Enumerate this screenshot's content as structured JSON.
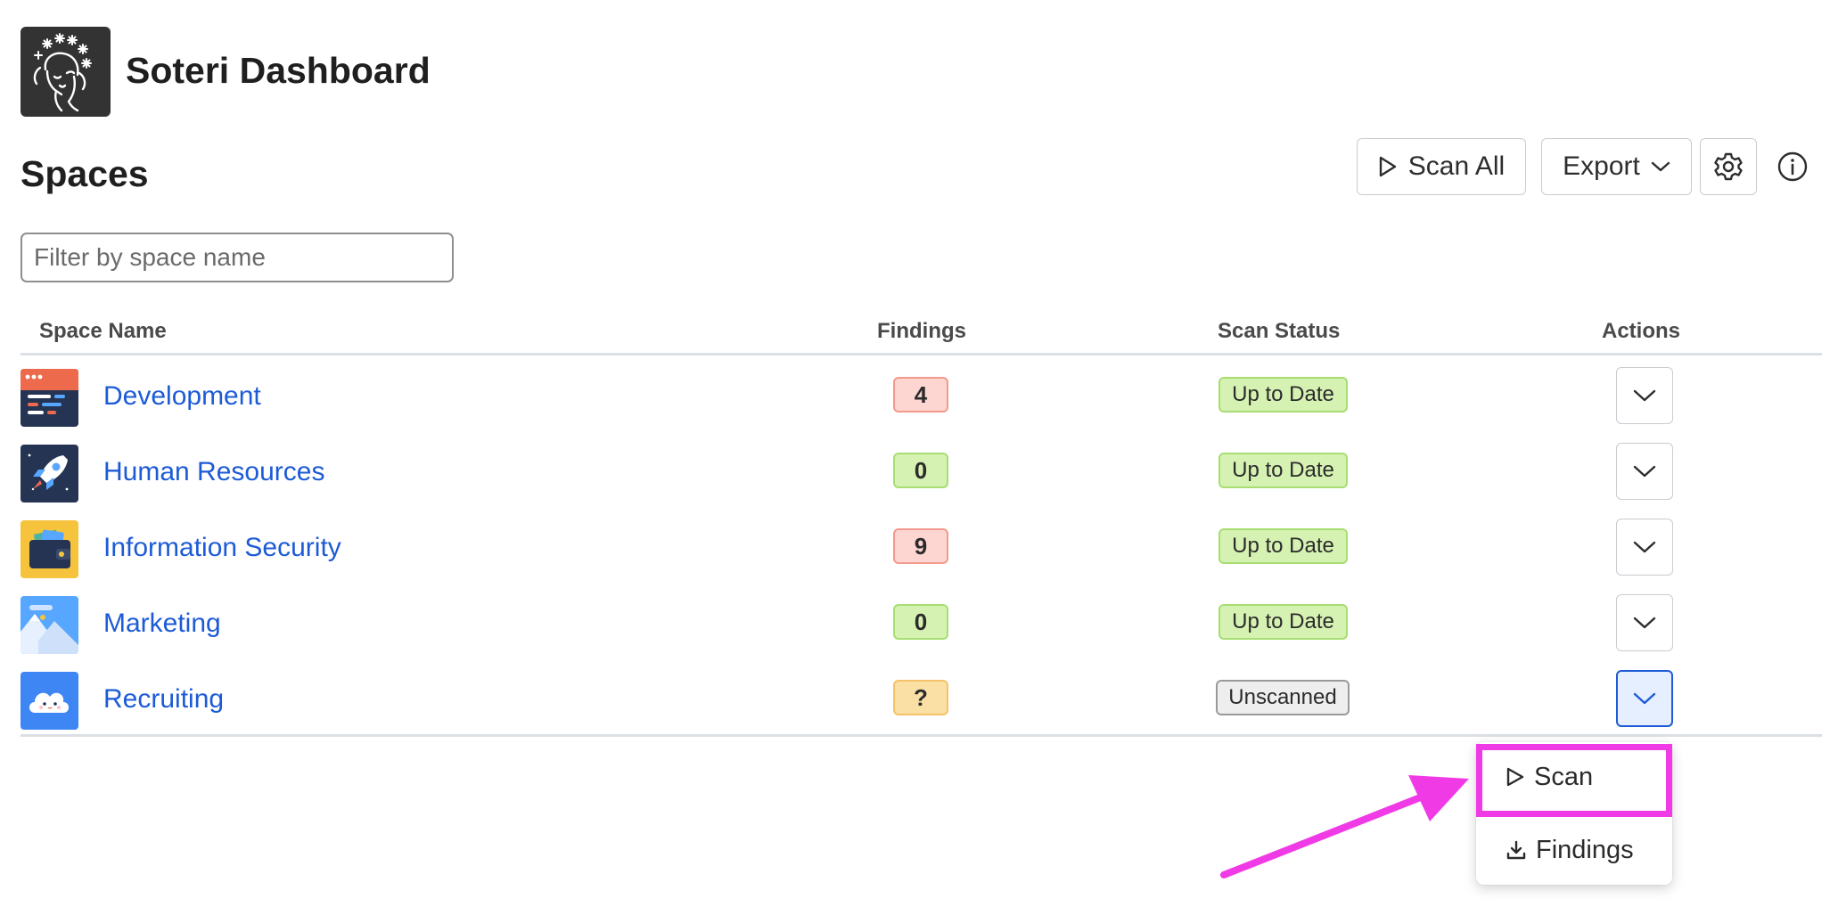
{
  "header": {
    "app_title": "Soteri Dashboard",
    "logo_icon": "woman-face-stars-icon"
  },
  "page": {
    "title": "Spaces"
  },
  "toolbar": {
    "scan_all_label": "Scan All",
    "export_label": "Export",
    "settings_icon": "gear-icon",
    "info_icon": "info-icon"
  },
  "filter": {
    "placeholder": "Filter by space name",
    "value": ""
  },
  "table": {
    "headers": {
      "name": "Space Name",
      "findings": "Findings",
      "status": "Scan Status",
      "actions": "Actions"
    },
    "rows": [
      {
        "name": "Development",
        "icon": "code-window-icon",
        "findings": "4",
        "findings_level": "red",
        "status": "Up to Date"
      },
      {
        "name": "Human Resources",
        "icon": "rocket-icon",
        "findings": "0",
        "findings_level": "green",
        "status": "Up to Date"
      },
      {
        "name": "Information Security",
        "icon": "wallet-icon",
        "findings": "9",
        "findings_level": "red",
        "status": "Up to Date"
      },
      {
        "name": "Marketing",
        "icon": "mountains-icon",
        "findings": "0",
        "findings_level": "green",
        "status": "Up to Date"
      },
      {
        "name": "Recruiting",
        "icon": "cloud-icon",
        "findings": "?",
        "findings_level": "amber",
        "status": "Unscanned"
      }
    ]
  },
  "dropdown": {
    "scan_label": "Scan",
    "findings_label": "Findings"
  },
  "colors": {
    "link": "#1d5bd6",
    "highlight": "#f03ae6",
    "logo_bg": "#333333"
  }
}
